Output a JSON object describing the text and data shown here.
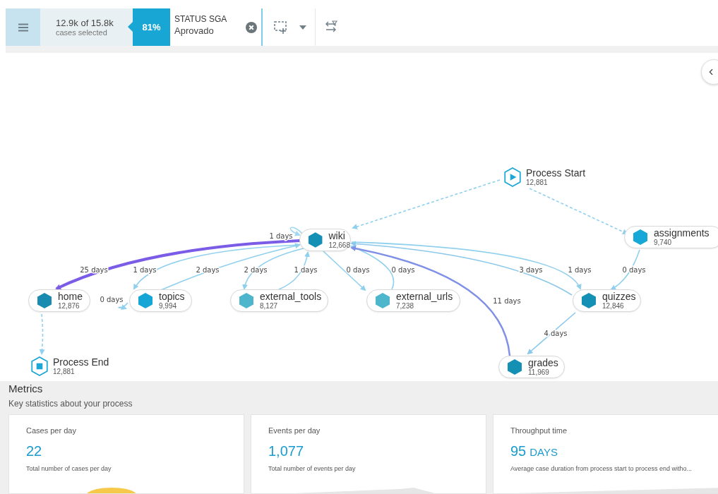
{
  "toolbar": {
    "selection": {
      "count": "12.9k of 15.8k",
      "caption": "cases selected",
      "percent": "81%"
    },
    "filter": {
      "name": "STATUS SGA",
      "value": "Aprovado"
    }
  },
  "process_map": {
    "nodes": [
      {
        "kind": "start",
        "name": "Process Start",
        "count": "12,881"
      },
      {
        "kind": "activity",
        "name": "wiki",
        "count": "12,668",
        "color": "#1590b5"
      },
      {
        "kind": "activity",
        "name": "assignments",
        "count": "9,740",
        "color": "#17a8d8"
      },
      {
        "kind": "activity",
        "name": "home",
        "count": "12,876",
        "color": "#1a8bb0"
      },
      {
        "kind": "activity",
        "name": "topics",
        "count": "9,994",
        "color": "#16a6d6"
      },
      {
        "kind": "activity",
        "name": "external_tools",
        "count": "8,127",
        "color": "#4db6cc"
      },
      {
        "kind": "activity",
        "name": "external_urls",
        "count": "7,238",
        "color": "#4db6cc"
      },
      {
        "kind": "activity",
        "name": "quizzes",
        "count": "12,846",
        "color": "#1590b5"
      },
      {
        "kind": "end",
        "name": "Process End",
        "count": "12,881"
      },
      {
        "kind": "activity",
        "name": "grades",
        "count": "11,969",
        "color": "#1590b5"
      }
    ],
    "edges": [
      {
        "kind": "solid",
        "label": "25 days",
        "color": "#7b5ce6"
      },
      {
        "kind": "solid",
        "label": "1 days",
        "color": "#9fd8ef"
      },
      {
        "kind": "solid",
        "label": "1 days",
        "color": "#8fd0ee"
      },
      {
        "kind": "solid",
        "label": "2 days",
        "color": "#8fd0ee"
      },
      {
        "kind": "solid",
        "label": "2 days",
        "color": "#8fd0ee"
      },
      {
        "kind": "solid",
        "label": "1 days",
        "color": "#8fd0ee"
      },
      {
        "kind": "solid",
        "label": "0 days",
        "color": "#8fd0ee"
      },
      {
        "kind": "solid",
        "label": "0 days",
        "color": "#8fd0ee"
      },
      {
        "kind": "solid",
        "label": "3 days",
        "color": "#8cc8ea"
      },
      {
        "kind": "solid",
        "label": "1 days",
        "color": "#8fd0ee"
      },
      {
        "kind": "solid",
        "label": "11 days",
        "color": "#7f90e6"
      },
      {
        "kind": "solid",
        "label": "0 days",
        "color": "#8fd0ee"
      },
      {
        "kind": "solid",
        "label": "4 days",
        "color": "#8cc8ea"
      },
      {
        "kind": "dashed",
        "color": "#8fd0ee"
      },
      {
        "kind": "dashed",
        "color": "#8fd0ee"
      },
      {
        "kind": "dashed",
        "color": "#8fd0ee"
      },
      {
        "kind": "solid",
        "label": "0 days",
        "color": "#8fd0ee"
      }
    ]
  },
  "metrics": {
    "title": "Metrics",
    "subtitle": "Key statistics about your process",
    "cards": [
      {
        "label": "Cases per day",
        "value": "22",
        "description": "Total number of cases per day"
      },
      {
        "label": "Events per day",
        "value": "1,077",
        "description": "Total number of events per day"
      },
      {
        "label": "Throughput time",
        "value": "95",
        "unit": "DAYS",
        "description": "Average case duration from process start to process end witho..."
      }
    ]
  }
}
